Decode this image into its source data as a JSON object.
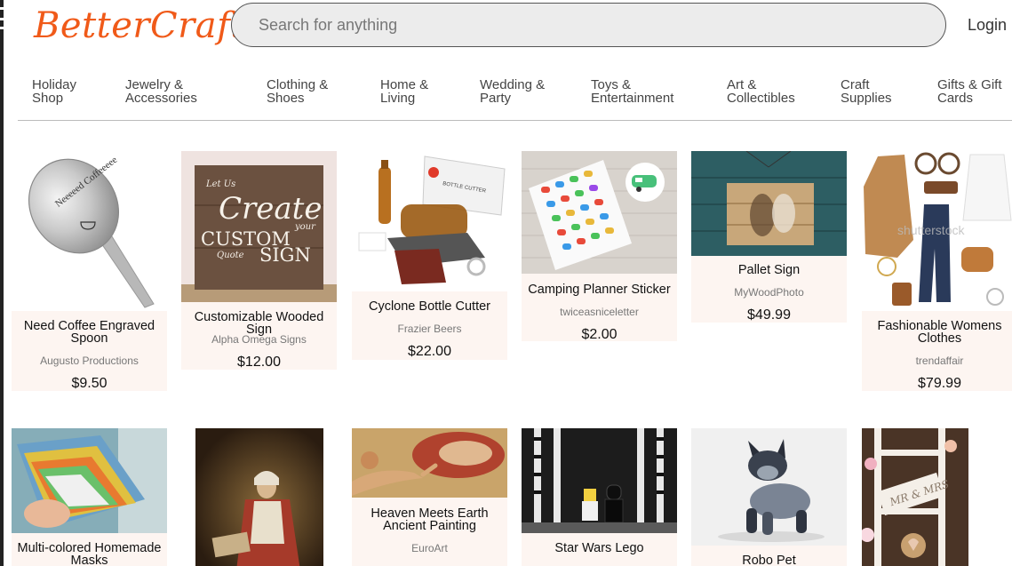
{
  "header": {
    "logo": "BetterCraft",
    "search_placeholder": "Search for anything",
    "login_label": "Login"
  },
  "nav": {
    "categories": [
      {
        "line1": "Holiday",
        "line2": "Shop"
      },
      {
        "line1": "Jewelry &",
        "line2": "Accessories"
      },
      {
        "line1": "Clothing &",
        "line2": "Shoes"
      },
      {
        "line1": "Home &",
        "line2": "Living"
      },
      {
        "line1": "Wedding &",
        "line2": "Party"
      },
      {
        "line1": "Toys &",
        "line2": "Entertainment"
      },
      {
        "line1": "Art &",
        "line2": "Collectibles"
      },
      {
        "line1": "Craft",
        "line2": "Supplies"
      },
      {
        "line1": "Gifts & Gift",
        "line2": "Cards"
      }
    ]
  },
  "products": [
    {
      "name": "Need Coffee Engraved Spoon",
      "seller": "Augusto Productions",
      "price": "$9.50",
      "image_icon": "engraved-spoon-image",
      "engraving": "Neeeeed Coffeeeee"
    },
    {
      "name": "Customizable Wooded Sign",
      "seller": "Alpha Omega Signs",
      "price": "$12.00",
      "image_icon": "wooden-sign-image",
      "sign_text": {
        "line1": "Let Us",
        "line2": "Create",
        "line3": "your",
        "line4": "CUSTOM",
        "line5": "Quote",
        "line6": "SIGN"
      }
    },
    {
      "name": "Cyclone Bottle Cutter",
      "seller": "Frazier Beers",
      "price": "$22.00",
      "image_icon": "bottle-cutter-image",
      "box_text": "BOTTLE CUTTER"
    },
    {
      "name": "Camping Planner Sticker",
      "seller": "twiceasniceletter",
      "price": "$2.00",
      "image_icon": "camper-stickers-image"
    },
    {
      "name": "Pallet Sign",
      "seller": "MyWoodPhoto",
      "price": "$49.99",
      "image_icon": "pallet-sign-image"
    },
    {
      "name": "Fashionable Womens Clothes",
      "seller": "trendaffair",
      "price": "$79.99",
      "image_icon": "clothes-collage-image",
      "watermark": "shutterstock"
    },
    {
      "name": "Multi-colored Homemade Masks",
      "seller": "",
      "price": "",
      "image_icon": "fabric-masks-image"
    },
    {
      "name": "",
      "seller": "",
      "price": "",
      "image_icon": "reading-woman-painting-image"
    },
    {
      "name": "Heaven Meets Earth Ancient Painting",
      "seller": "EuroArt",
      "price": "",
      "image_icon": "creation-of-adam-image"
    },
    {
      "name": "Star Wars Lego",
      "seller": "",
      "price": "",
      "image_icon": "lego-figures-image"
    },
    {
      "name": "Robo Pet",
      "seller": "",
      "price": "",
      "image_icon": "robot-dog-image"
    },
    {
      "name": "",
      "seller": "",
      "price": "",
      "image_icon": "wedding-ladder-image",
      "sign_text": "MR & MRS"
    }
  ]
}
